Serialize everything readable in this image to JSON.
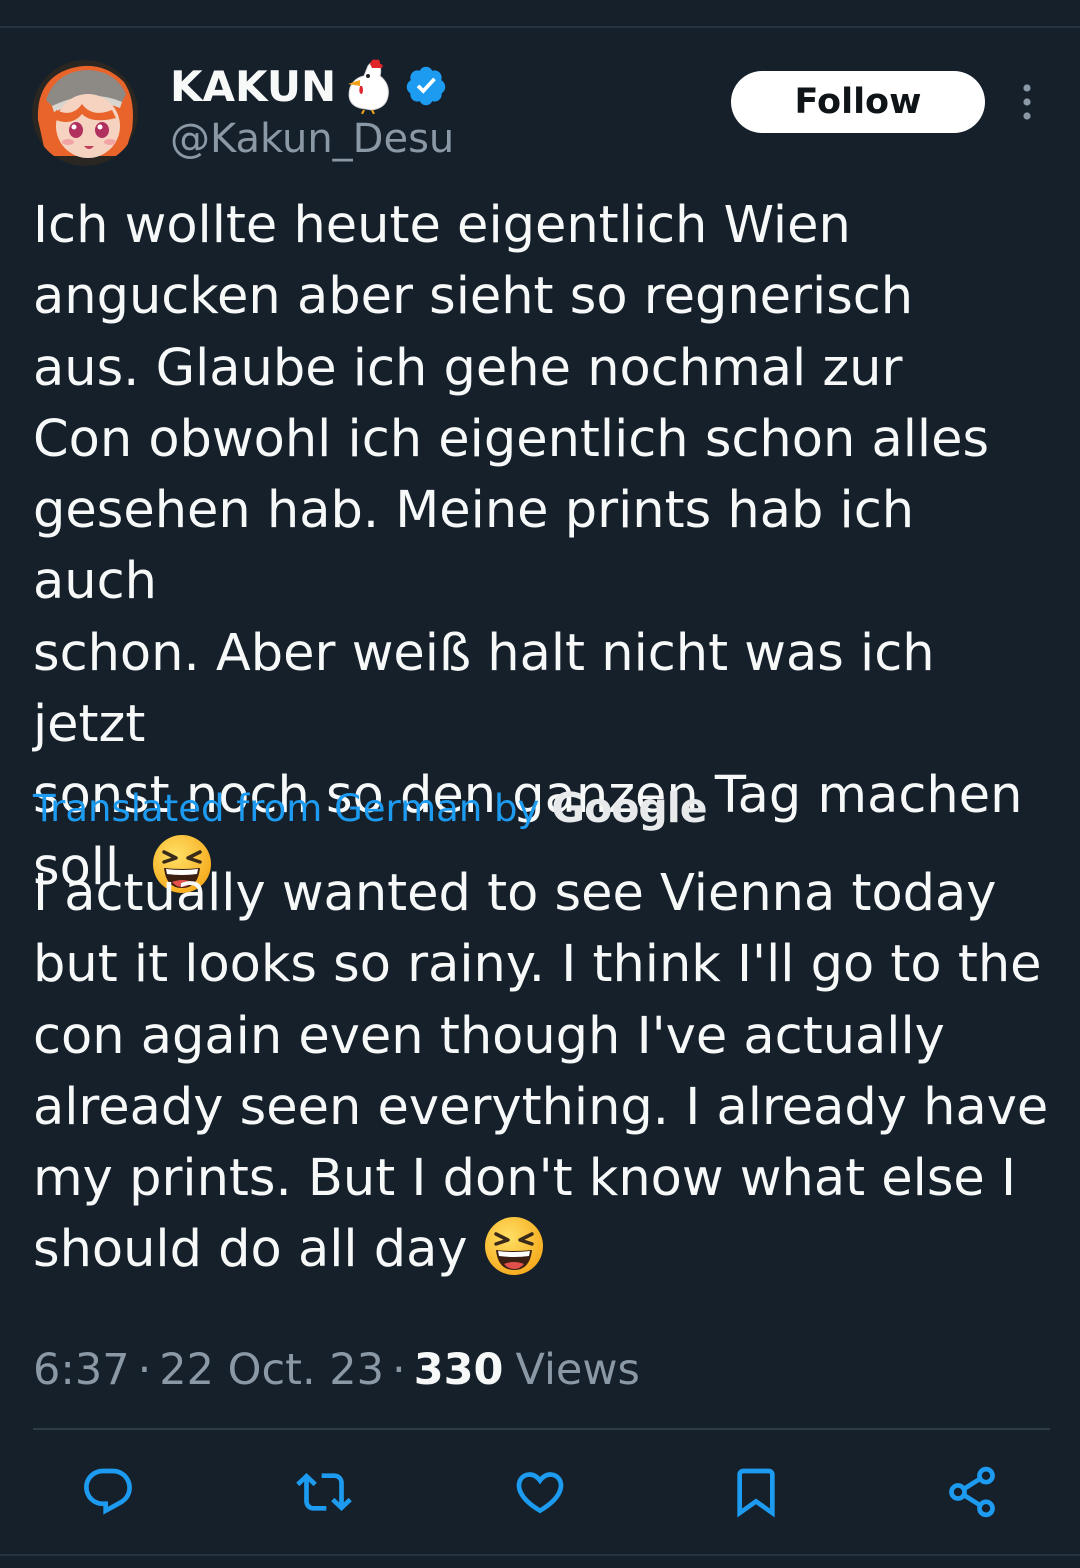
{
  "header": {
    "display_name": "KAKUN",
    "handle": "@Kakun_Desu",
    "follow_label": "Follow"
  },
  "tweet": {
    "original_text": "Ich wollte heute eigentlich Wien\nangucken aber sieht so regnerisch\naus. Glaube ich gehe nochmal zur\nCon obwohl ich eigentlich schon alles\ngesehen hab. Meine prints hab ich auch\nschon. Aber weiß halt nicht was ich jetzt\nsonst noch so den ganzen Tag machen\nsoll  ",
    "translation_label": "Translated from German by",
    "translation_provider": "Google",
    "translated_text": "I actually wanted to see Vienna today\nbut it looks so rainy. I think I'll go to the\ncon again even though I've actually\nalready seen everything. I already have\nmy prints. But I don't know what else I\nshould do all day "
  },
  "meta": {
    "time": "6:37",
    "separator": "·",
    "date": "22 Oct. 23",
    "views_count": "330",
    "views_label": "Views"
  },
  "icons": {
    "header": [
      "avatar",
      "chicken-icon",
      "verified-icon",
      "more-icon"
    ],
    "emoji": "laughing-squint-emoji",
    "actions": [
      "reply-icon",
      "retweet-icon",
      "like-icon",
      "bookmark-icon",
      "share-icon"
    ]
  },
  "colors": {
    "background": "#15202b",
    "text": "#f7f9f9",
    "secondary_text": "#8b98a5",
    "link": "#1d9bf0",
    "verified": "#1d9bf0",
    "follow_button_bg": "#ffffff",
    "follow_button_text": "#0f1419",
    "divider": "#2f3b47"
  }
}
